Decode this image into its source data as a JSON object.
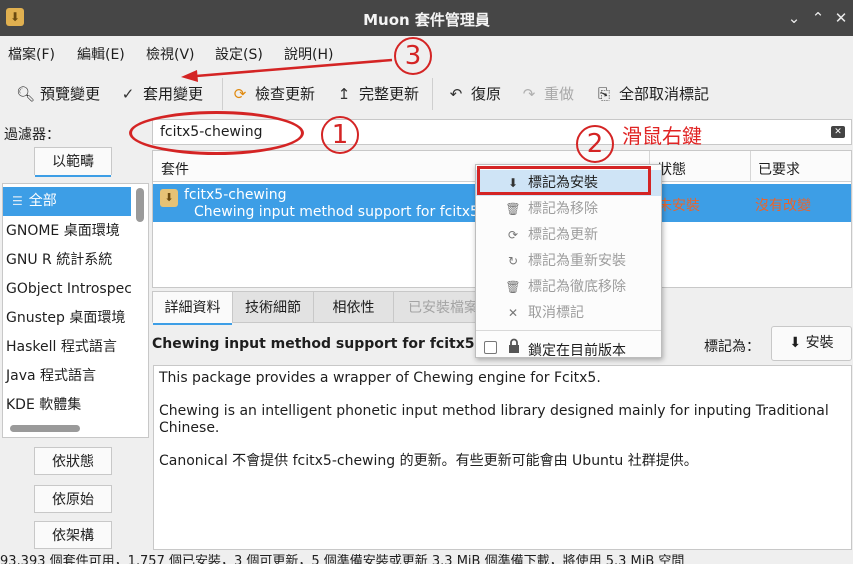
{
  "window": {
    "title": "Muon 套件管理員",
    "app_icon": "package-icon",
    "controls": [
      "minimize-icon",
      "maximize-icon",
      "close-icon"
    ]
  },
  "menubar": [
    "檔案(F)",
    "編輯(E)",
    "檢視(V)",
    "設定(S)",
    "說明(H)"
  ],
  "toolbar": {
    "preview": {
      "label": "預覽變更",
      "icon": "search-icon"
    },
    "apply": {
      "label": "套用變更",
      "icon": "check-icon"
    },
    "check_updates": {
      "label": "檢查更新",
      "icon": "refresh-icon"
    },
    "full_upgrade": {
      "label": "完整更新",
      "icon": "upgrade-icon"
    },
    "undo": {
      "label": "復原",
      "icon": "undo-icon"
    },
    "redo": {
      "label": "重做",
      "icon": "redo-icon"
    },
    "unmark_all": {
      "label": "全部取消標記",
      "icon": "unmark-all-icon"
    }
  },
  "filter": {
    "label": "過濾器：",
    "search_value": "fcitx5-chewing"
  },
  "sidebar": {
    "scope_tab": "以範疇",
    "categories": [
      "全部",
      "GNOME 桌面環境",
      "GNU R 統計系統",
      "GObject Introspec",
      "Gnustep 桌面環境",
      "Haskell 程式語言",
      "Java 程式語言",
      "KDE 軟體集"
    ],
    "buttons": [
      "依狀態",
      "依原始",
      "依架構"
    ]
  },
  "table": {
    "headers": {
      "package": "套件",
      "status": "狀態",
      "requested": "已要求"
    },
    "row": {
      "name": "fcitx5-chewing",
      "description": "Chewing input method support for fcitx5",
      "status": "未安裝",
      "requested": "沒有改變"
    }
  },
  "context_menu": {
    "items": [
      {
        "label": "標記為安裝",
        "icon": "download-icon",
        "enabled": true
      },
      {
        "label": "標記為移除",
        "icon": "trash-icon",
        "enabled": false
      },
      {
        "label": "標記為更新",
        "icon": "refresh-icon",
        "enabled": false
      },
      {
        "label": "標記為重新安裝",
        "icon": "redo-icon",
        "enabled": false
      },
      {
        "label": "標記為徹底移除",
        "icon": "trash-icon",
        "enabled": false
      },
      {
        "label": "取消標記",
        "icon": "x-icon",
        "enabled": false
      }
    ],
    "lock_label": "鎖定在目前版本"
  },
  "detail_tabs": [
    "詳細資料",
    "技術細節",
    "相依性",
    "已安裝檔案"
  ],
  "details": {
    "short_description": "Chewing input method support for fcitx5",
    "mark_as_label": "標記為：",
    "install_button": "安裝",
    "paragraphs": [
      "This package provides a wrapper of Chewing engine for Fcitx5.",
      "Chewing is an intelligent phonetic input method library designed mainly for inputing Traditional Chinese.",
      "Canonical 不會提供 fcitx5-chewing 的更新。有些更新可能會由 Ubuntu 社群提供。"
    ]
  },
  "statusbar": {
    "text": "93,393 個套件可用，1,757 個已安裝，3 個可更新，5 個準備安裝或更新 3.3 MiB 個準備下載，將使用 5.3 MiB 空間"
  },
  "annotations": {
    "step1": "1",
    "step2": "2",
    "step3": "3",
    "right_click_note": "滑鼠右鍵",
    "color": "#d42424"
  },
  "colors": {
    "accent": "#3d9ee6",
    "warning_text": "#e8652c",
    "titlebar": "#464646"
  }
}
